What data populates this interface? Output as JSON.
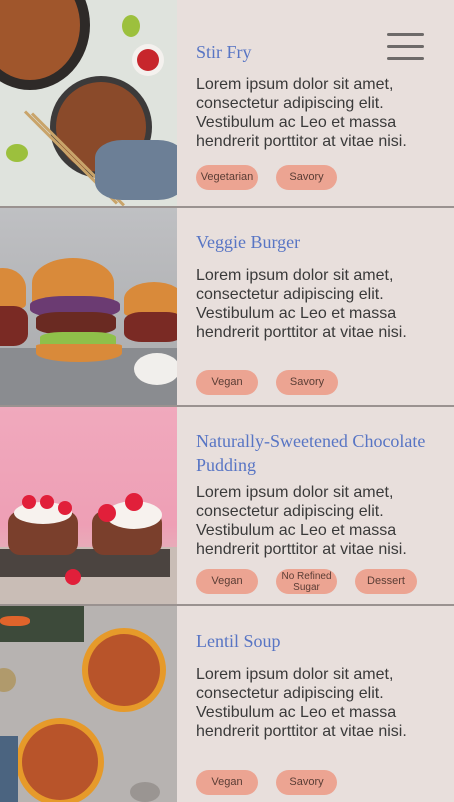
{
  "menu": {
    "icon": "hamburger-menu-icon"
  },
  "colors": {
    "background": "#e8dfdc",
    "title": "#5875c4",
    "tag": "#eca492",
    "divider": "#9a9290"
  },
  "recipes": [
    {
      "title": "Stir Fry",
      "description": "Lorem ipsum dolor sit amet, consectetur adipiscing elit. Vestibulum ac Leo et massa hendrerit porttitor at vitae nisi.",
      "tags": [
        "Vegetarian",
        "Savory"
      ]
    },
    {
      "title": "Veggie Burger",
      "description": "Lorem ipsum dolor sit amet, consectetur adipiscing elit. Vestibulum ac Leo et massa hendrerit porttitor at vitae nisi.",
      "tags": [
        "Vegan",
        "Savory"
      ]
    },
    {
      "title": "Naturally-Sweetened Chocolate Pudding",
      "description": "Lorem ipsum dolor sit amet, consectetur adipiscing elit. Vestibulum ac Leo et massa hendrerit porttitor at vitae nisi.",
      "tags": [
        "Vegan",
        "No Refined Sugar",
        "Dessert"
      ]
    },
    {
      "title": "Lentil Soup",
      "description": "Lorem ipsum dolor sit amet, consectetur adipiscing elit. Vestibulum ac Leo et massa hendrerit porttitor at vitae nisi.",
      "tags": [
        "Vegan",
        "Savory"
      ]
    }
  ]
}
